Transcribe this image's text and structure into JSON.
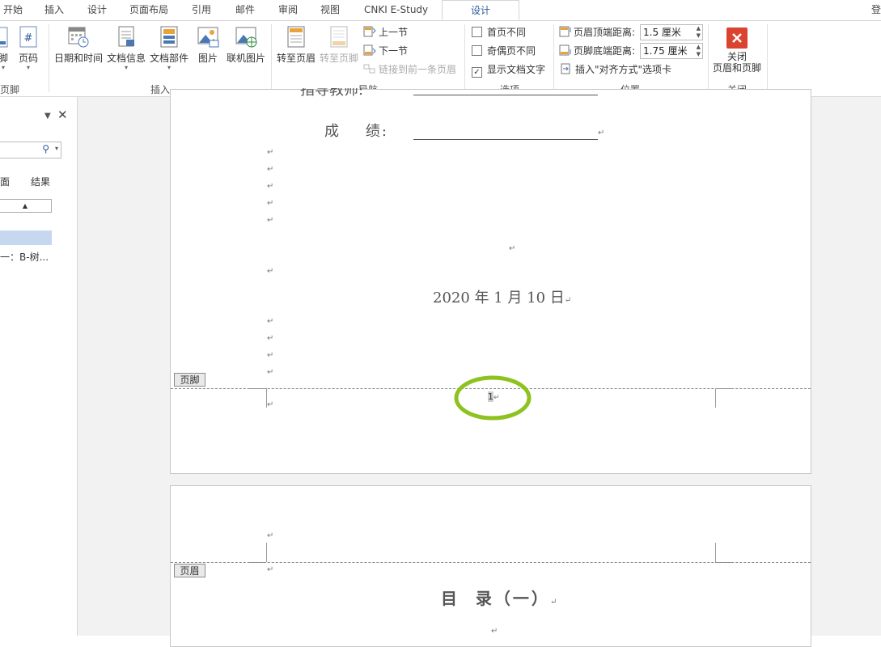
{
  "tabs": [
    {
      "label": "开始"
    },
    {
      "label": "插入"
    },
    {
      "label": "设计"
    },
    {
      "label": "页面布局"
    },
    {
      "label": "引用"
    },
    {
      "label": "邮件"
    },
    {
      "label": "审阅"
    },
    {
      "label": "视图"
    },
    {
      "label": "CNKI E-Study"
    },
    {
      "label": "设计"
    }
  ],
  "account_label": "登",
  "ribbon": {
    "hf_group": {
      "label": "页脚",
      "footer_btn": "脚",
      "pagenum_btn": "页码"
    },
    "insert_group": {
      "label": "插入",
      "datetime": "日期和时间",
      "docinfo": "文档信息",
      "docparts": "文档部件",
      "picture": "图片",
      "online_picture": "联机图片"
    },
    "nav_group": {
      "label": "导航",
      "goto_header": "转至页眉",
      "goto_footer": "转至页脚",
      "prev_section": "上一节",
      "next_section": "下一节",
      "link_prev": "链接到前一条页眉"
    },
    "options_group": {
      "label": "选项",
      "diff_first": "首页不同",
      "diff_odd_even": "奇偶页不同",
      "show_doc_text": "显示文档文字",
      "diff_first_checked": false,
      "diff_odd_even_checked": false,
      "show_doc_text_checked": true
    },
    "position_group": {
      "label": "位置",
      "header_top_label": "页眉顶端距离:",
      "header_top_value": "1.5 厘米",
      "footer_bottom_label": "页脚底端距离:",
      "footer_bottom_value": "1.75 厘米",
      "insert_align_tab": "插入\"对齐方式\"选项卡"
    },
    "close_group": {
      "label": "关闭",
      "close_btn_line1": "关闭",
      "close_btn_line2": "页眉和页脚"
    }
  },
  "nav_pane": {
    "tab_pages": "面",
    "tab_results": "结果",
    "result_item": "一：B-树..."
  },
  "document": {
    "teacher_label": "指导教师:",
    "grade_label": "成    绩:",
    "date_text": "2020 年 1 月 10 日",
    "footer_tag": "页脚",
    "page_number": "1",
    "header_tag": "页眉",
    "toc_title": "目  录（一）",
    "para_mark": "↵"
  },
  "colors": {
    "accent": "#2b579a",
    "highlight_circle": "#8dc21f",
    "close_red": "#d9432f"
  }
}
